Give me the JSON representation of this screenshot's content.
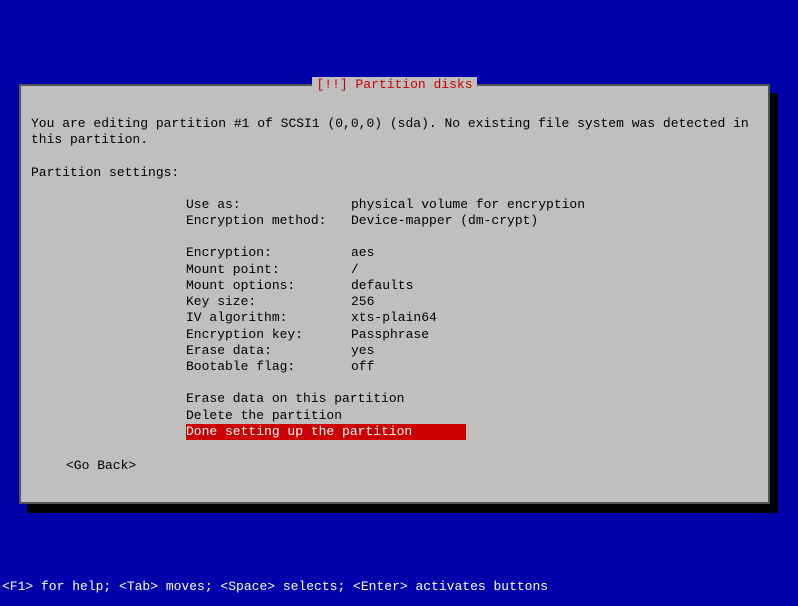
{
  "dialog": {
    "title": "[!!] Partition disks",
    "intro": "You are editing partition #1 of SCSI1 (0,0,0) (sda). No existing file system was detected in this partition.",
    "section_header": "Partition settings:",
    "settings": [
      {
        "label": "Use as:",
        "value": "physical volume for encryption"
      },
      {
        "label": "Encryption method:",
        "value": "Device-mapper (dm-crypt)"
      }
    ],
    "settings2": [
      {
        "label": "Encryption:",
        "value": "aes"
      },
      {
        "label": "Mount point:",
        "value": "/"
      },
      {
        "label": "Mount options:",
        "value": "defaults"
      },
      {
        "label": "Key size:",
        "value": "256"
      },
      {
        "label": "IV algorithm:",
        "value": "xts-plain64"
      },
      {
        "label": "Encryption key:",
        "value": "Passphrase"
      },
      {
        "label": "Erase data:",
        "value": "yes"
      },
      {
        "label": "Bootable flag:",
        "value": "off"
      }
    ],
    "actions": [
      {
        "label": "Erase data on this partition",
        "selected": false
      },
      {
        "label": "Delete the partition",
        "selected": false
      },
      {
        "label": "Done setting up the partition",
        "selected": true
      }
    ],
    "go_back": "<Go Back>"
  },
  "help_bar": "<F1> for help; <Tab> moves; <Space> selects; <Enter> activates buttons"
}
